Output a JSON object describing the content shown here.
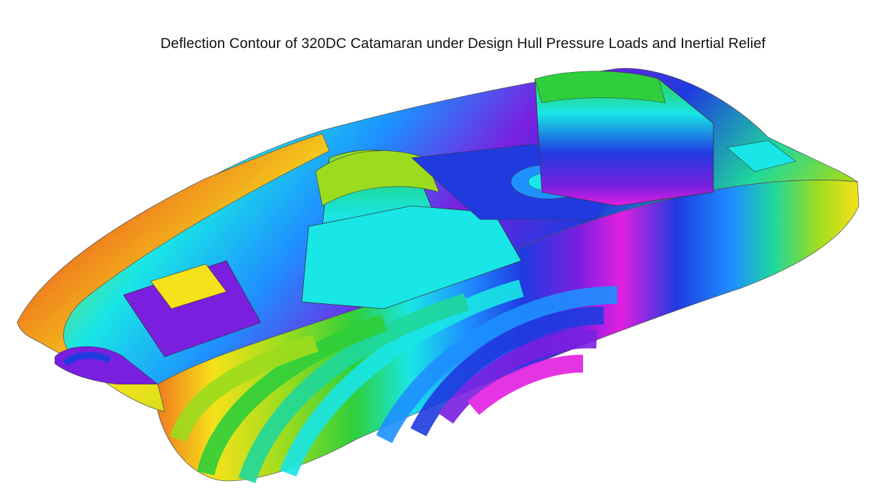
{
  "figure": {
    "title": "Deflection Contour of 320DC Catamaran under Design Hull Pressure Loads and Inertial Relief"
  },
  "palette": {
    "background": "#ffffff",
    "contour_colors": [
      "#d7191c",
      "#f07c1e",
      "#f5e21a",
      "#9cdc1e",
      "#2fcf3b",
      "#1fd99b",
      "#19e6e6",
      "#1e90ff",
      "#1f3be0",
      "#7a1fe0",
      "#e21fe0"
    ]
  }
}
